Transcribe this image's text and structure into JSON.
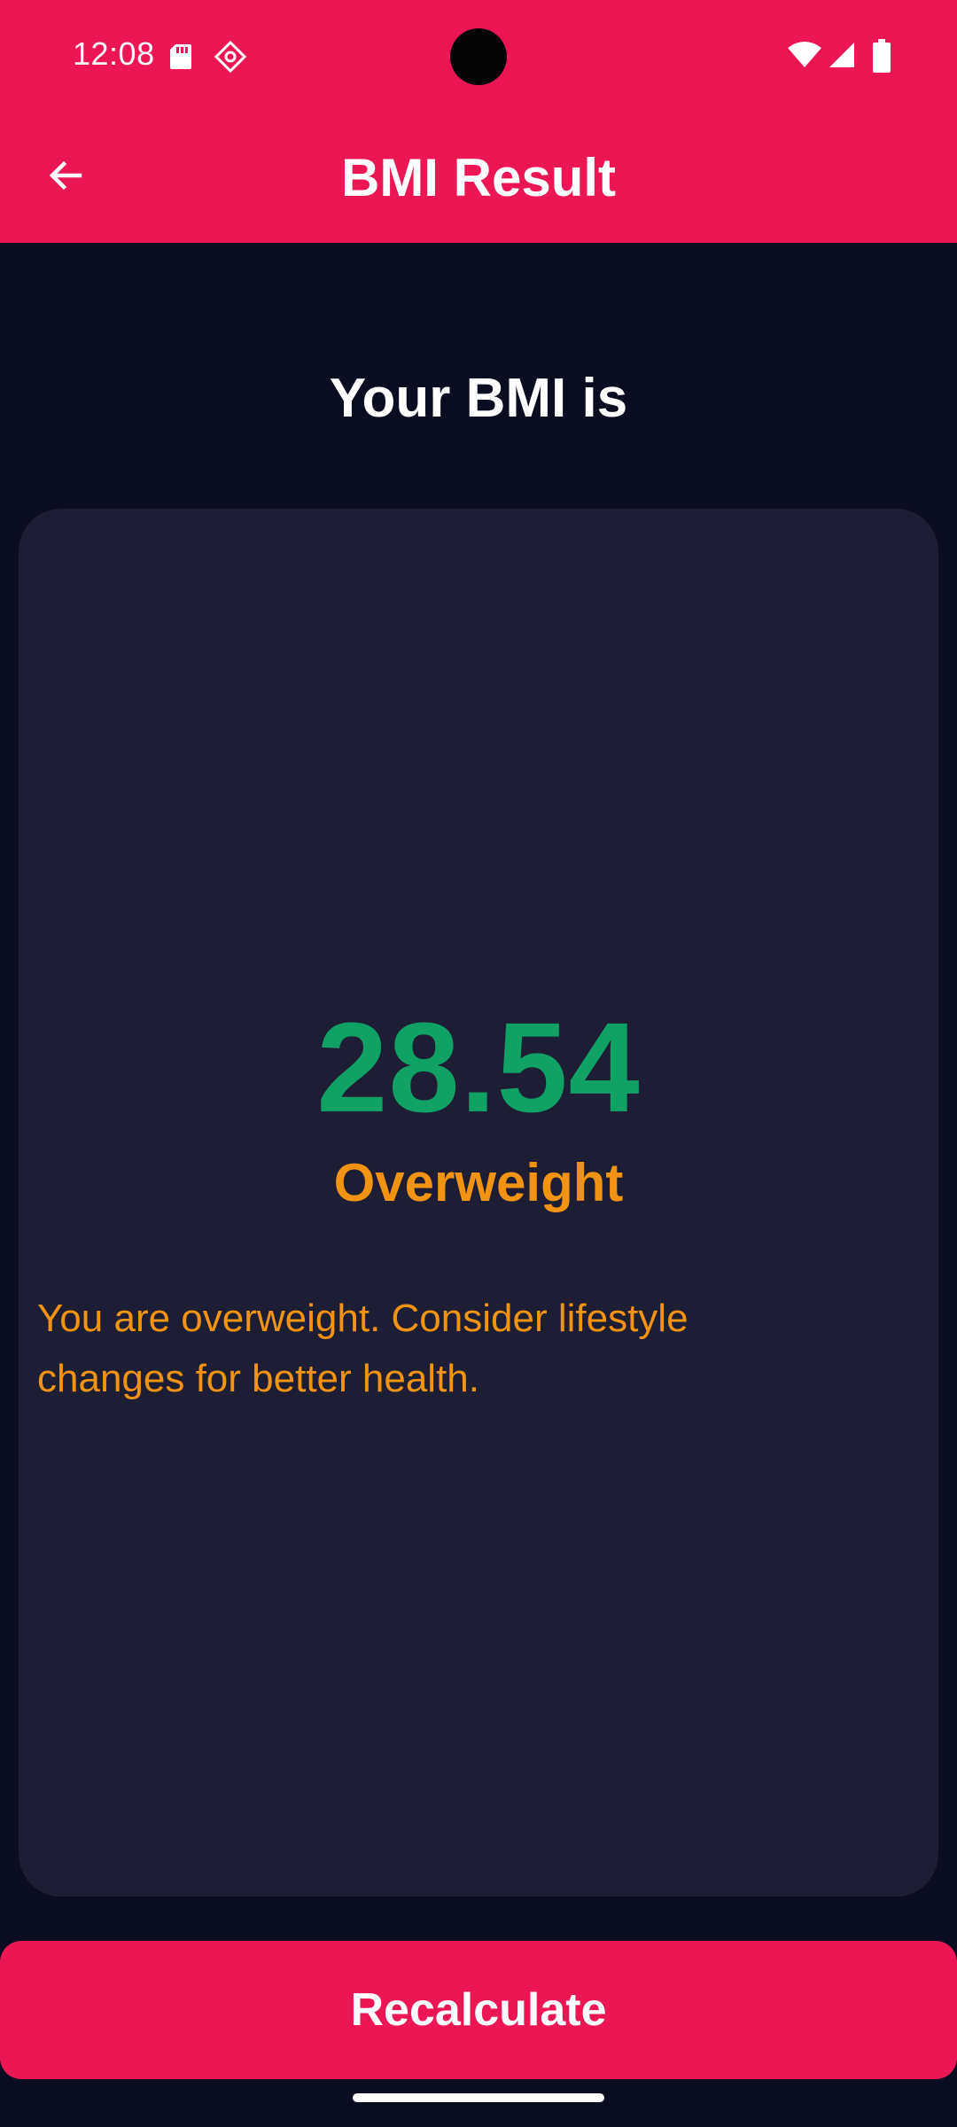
{
  "status_bar": {
    "time": "12:08",
    "icons": [
      "sd-card-icon",
      "gear-icon",
      "wifi-icon",
      "cell-signal-icon",
      "battery-icon"
    ]
  },
  "app_bar": {
    "title": "BMI Result",
    "back_icon": "arrow-left-icon"
  },
  "main": {
    "headline": "Your BMI is",
    "result": {
      "value": "28.54",
      "category": "Overweight",
      "advice": "You are overweight. Consider lifestyle changes for better health."
    }
  },
  "actions": {
    "recalculate_label": "Recalculate"
  },
  "colors": {
    "accent": "#ec1655",
    "background": "#0a0c1f",
    "card": "#1d1e33",
    "value": "#10a165",
    "category": "#f39313"
  }
}
